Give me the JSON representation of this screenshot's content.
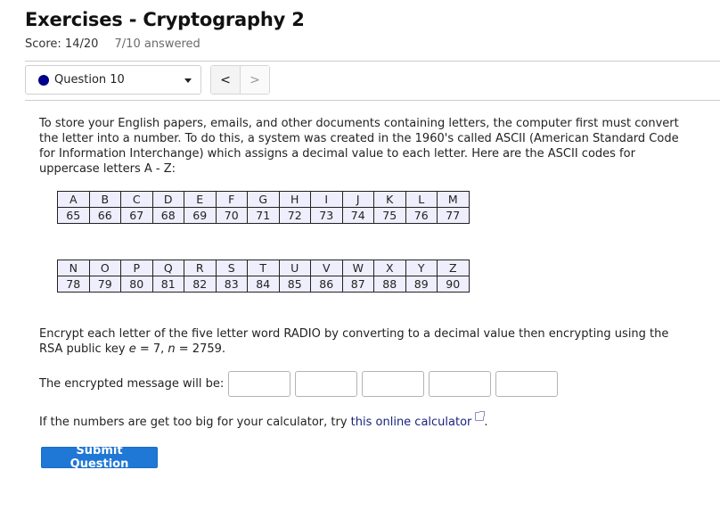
{
  "header": {
    "title": "Exercises - Cryptography 2",
    "score": "Score: 14/20",
    "answered": "7/10 answered"
  },
  "nav": {
    "question_selected": "Question 10",
    "status_dot_color": "#00008b",
    "prev_icon": "chevron-left-icon",
    "next_icon": "chevron-right-icon",
    "prev_glyph": "<",
    "next_glyph": ">"
  },
  "question": {
    "intro": "To store your English papers, emails, and other documents containing letters, the computer first must convert the letter into a number. To do this, a system was created in the 1960's called ASCII (American Standard Code for Information Interchange) which assigns a decimal value to each letter. Here are the ASCII codes for uppercase letters A - Z:",
    "ascii_table_1": {
      "letters": [
        "A",
        "B",
        "C",
        "D",
        "E",
        "F",
        "G",
        "H",
        "I",
        "J",
        "K",
        "L",
        "M"
      ],
      "codes": [
        "65",
        "66",
        "67",
        "68",
        "69",
        "70",
        "71",
        "72",
        "73",
        "74",
        "75",
        "76",
        "77"
      ]
    },
    "ascii_table_2": {
      "letters": [
        "N",
        "O",
        "P",
        "Q",
        "R",
        "S",
        "T",
        "U",
        "V",
        "W",
        "X",
        "Y",
        "Z"
      ],
      "codes": [
        "78",
        "79",
        "80",
        "81",
        "82",
        "83",
        "84",
        "85",
        "86",
        "87",
        "88",
        "89",
        "90"
      ]
    },
    "instruction_prefix": "Encrypt each letter of the five letter word RADIO by converting to a decimal value then encrypting using the RSA public key ",
    "var_e": "e",
    "eq_e": " = 7, ",
    "var_n": "n",
    "eq_n": " = 2759.",
    "answer_label": "The encrypted message will be:",
    "answers": [
      "",
      "",
      "",
      "",
      ""
    ],
    "hint_prefix": "If the numbers are get too big for your calculator, try ",
    "hint_link": "this online calculator",
    "hint_link_icon": "external-link-icon",
    "hint_suffix": "."
  },
  "actions": {
    "submit_label": "Submit Question",
    "submit_color": "#1f77d6"
  }
}
